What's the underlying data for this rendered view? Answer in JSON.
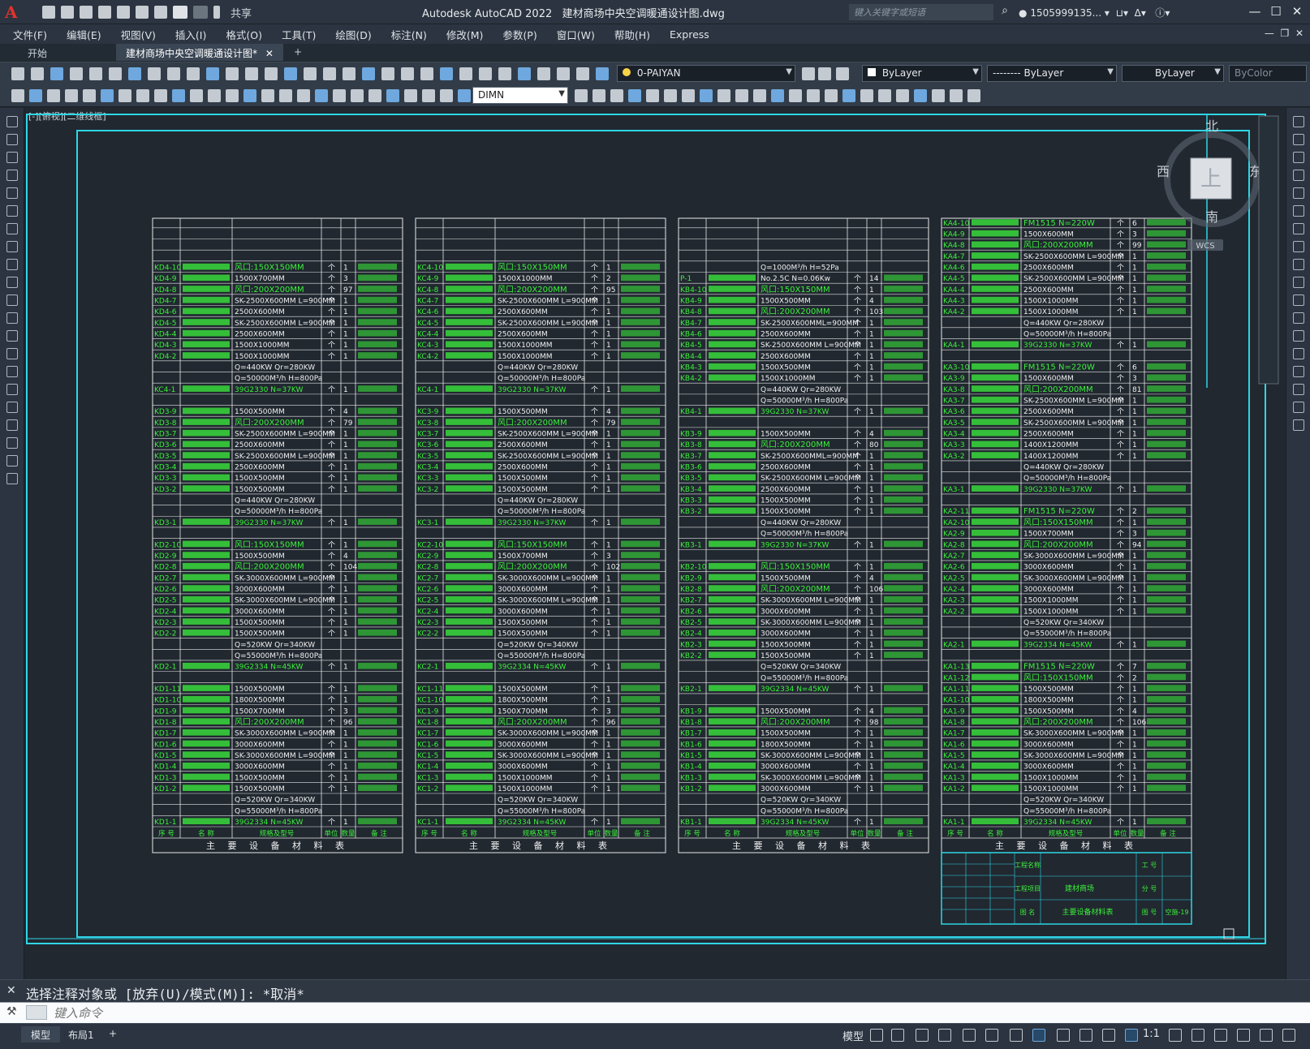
{
  "app": {
    "title": "Autodesk AutoCAD 2022",
    "filename": "建材商场中央空调暖通设计图.dwg",
    "share_label": "共享",
    "search_placeholder": "键入关键字或短语",
    "user": "1505999135...",
    "logo": "A"
  },
  "menu": [
    "文件(F)",
    "编辑(E)",
    "视图(V)",
    "插入(I)",
    "格式(O)",
    "工具(T)",
    "绘图(D)",
    "标注(N)",
    "修改(M)",
    "参数(P)",
    "窗口(W)",
    "帮助(H)",
    "Express"
  ],
  "tabs": {
    "start": "开始",
    "doc": "建材商场中央空调暖通设计图*",
    "close": "✕",
    "add": "+"
  },
  "toolbar": {
    "layer": "0-PAIYAN",
    "color": "ByLayer",
    "linetype": "-------- ByLayer",
    "lineweight": "ByLayer",
    "plotstyle": "ByColor",
    "dimstyle": "DIMN"
  },
  "viewport": {
    "label": "[-][俯视][二维线框]",
    "compass": {
      "n": "北",
      "s": "南",
      "e": "东",
      "w": "西",
      "top": "上"
    },
    "wcs": "WCS"
  },
  "drawing": {
    "table_title": "主 要 设 备 材 料 表",
    "headers": [
      "序 号",
      "名 称",
      "规格及型号",
      "单位",
      "数量",
      "备 注"
    ],
    "col1": [
      "KD4-10",
      "KD4-9",
      "KD4-8",
      "KD4-7",
      "KD4-6",
      "KD4-5",
      "KD4-4",
      "KD4-3",
      "KD4-2",
      "",
      "",
      "KC4-1",
      "",
      "KD3-9",
      "KD3-8",
      "KD3-7",
      "KD3-6",
      "KD3-5",
      "KD3-4",
      "KD3-3",
      "KD3-2",
      "",
      "",
      "KD3-1",
      "",
      "KD2-10",
      "KD2-9",
      "KD2-8",
      "KD2-7",
      "KD2-6",
      "KD2-5",
      "KD2-4",
      "KD2-3",
      "KD2-2",
      "",
      "",
      "KD2-1",
      "",
      "KD1-11",
      "KD1-10",
      "KD1-9",
      "KD1-8",
      "KD1-7",
      "KD1-6",
      "KD1-5",
      "KD1-4",
      "KD1-3",
      "KD1-2",
      "",
      "",
      "KD1-1"
    ],
    "col2": [
      "KC4-10",
      "KC4-9",
      "KC4-8",
      "KC4-7",
      "KC4-6",
      "KC4-5",
      "KC4-4",
      "KC4-3",
      "KC4-2",
      "",
      "",
      "KC4-1",
      "",
      "KC3-9",
      "KC3-8",
      "KC3-7",
      "KC3-6",
      "KC3-5",
      "KC3-4",
      "KC3-3",
      "KC3-2",
      "",
      "",
      "KC3-1",
      "",
      "KC2-10",
      "KC2-9",
      "KC2-8",
      "KC2-7",
      "KC2-6",
      "KC2-5",
      "KC2-4",
      "KC2-3",
      "KC2-2",
      "",
      "",
      "KC2-1",
      "",
      "KC1-11",
      "KC1-10",
      "KC1-9",
      "KC1-8",
      "KC1-7",
      "KC1-6",
      "KC1-5",
      "KC1-4",
      "KC1-3",
      "KC1-2",
      "",
      "",
      "KC1-1"
    ],
    "col3": [
      "",
      "P-1",
      "KB4-10",
      "KB4-9",
      "KB4-8",
      "KB4-7",
      "KB4-6",
      "KB4-5",
      "KB4-4",
      "KB4-3",
      "KB4-2",
      "",
      "",
      "KB4-1",
      "",
      "KB3-9",
      "KB3-8",
      "KB3-7",
      "KB3-6",
      "KB3-5",
      "KB3-4",
      "KB3-3",
      "KB3-2",
      "",
      "",
      "KB3-1",
      "",
      "KB2-10",
      "KB2-9",
      "KB2-8",
      "KB2-7",
      "KB2-6",
      "KB2-5",
      "KB2-4",
      "KB2-3",
      "KB2-2",
      "",
      "",
      "KB2-1",
      "",
      "KB1-9",
      "KB1-8",
      "KB1-7",
      "KB1-6",
      "KB1-5",
      "KB1-4",
      "KB1-3",
      "KB1-2",
      "",
      "",
      "KB1-1"
    ],
    "col4": [
      "KA4-10",
      "KA4-9",
      "KA4-8",
      "KA4-7",
      "KA4-6",
      "KA4-5",
      "KA4-4",
      "KA4-3",
      "KA4-2",
      "",
      "",
      "KA4-1",
      "",
      "KA3-10",
      "KA3-9",
      "KA3-8",
      "KA3-7",
      "KA3-6",
      "KA3-5",
      "KA3-4",
      "KA3-3",
      "KA3-2",
      "",
      "",
      "KA3-1",
      "",
      "KA2-11",
      "KA2-10",
      "KA2-9",
      "KA2-8",
      "KA2-7",
      "KA2-6",
      "KA2-5",
      "KA2-4",
      "KA2-3",
      "KA2-2",
      "",
      "",
      "KA2-1",
      "",
      "KA1-13",
      "KA1-12",
      "KA1-11",
      "KA1-10",
      "KA1-9",
      "KA1-8",
      "KA1-7",
      "KA1-6",
      "KA1-5",
      "KA1-4",
      "KA1-3",
      "KA1-2",
      "",
      "",
      "KA1-1"
    ],
    "specs_a": {
      "KD4-10": "风口:150X150MM",
      "KD4-9": "1500X700MM",
      "KD4-8": "风口:200X200MM",
      "KD4-7": "SK-2500X600MM L=900MM",
      "KD4-6": "2500X600MM",
      "KD4-5": "SK-2500X600MM L=900MM",
      "KD4-4": "2500X600MM",
      "KD4-3": "1500X1000MM",
      "KD4-2": "1500X1000MM",
      "KD3-9": "1500X500MM",
      "KD3-8": "风口:200X200MM",
      "KD3-7": "SK-2500X600MM L=900MM",
      "KD3-6": "2500X600MM",
      "KD3-5": "SK-2500X600MM L=900MM",
      "KD3-4": "2500X600MM",
      "KD3-3": "1500X500MM",
      "KD3-2": "1500X500MM",
      "KD2-10": "风口:150X150MM",
      "KD2-9": "1500X500MM",
      "KD2-8": "风口:200X200MM",
      "KD2-7": "SK-3000X600MM L=900MM",
      "KD2-6": "3000X600MM",
      "KD2-5": "SK-3000X600MM L=900MM",
      "KD2-4": "3000X600MM",
      "KD2-3": "1500X500MM",
      "KD2-2": "1500X500MM",
      "KD1-11": "1500X500MM",
      "KD1-10": "1800X500MM",
      "KD1-9": "1500X700MM",
      "KD1-8": "风口:200X200MM",
      "KD1-7": "SK-3000X600MM L=900MM",
      "KD1-6": "3000X600MM",
      "KD1-5": "SK-3000X600MM L=900MM",
      "KD1-4": "3000X600MM",
      "KD1-3": "1500X500MM",
      "KD1-2": "1500X500MM",
      "KC4-10": "风口:150X150MM",
      "KC4-9": "1500X1000MM",
      "KC4-8": "风口:200X200MM",
      "KC4-7": "SK-2500X600MM L=900MM",
      "KC4-6": "2500X600MM",
      "KC4-5": "SK-2500X600MM L=900MM",
      "KC4-4": "2500X600MM",
      "KC4-3": "1500X1000MM",
      "KC4-2": "1500X1000MM",
      "KC3-9": "1500X500MM",
      "KC3-8": "风口:200X200MM",
      "KC3-7": "SK-2500X600MM L=900MM",
      "KC3-6": "2500X600MM",
      "KC3-5": "SK-2500X600MM L=900MM",
      "KC3-4": "2500X600MM",
      "KC3-3": "1500X500MM",
      "KC3-2": "1500X500MM",
      "KC2-10": "风口:150X150MM",
      "KC2-9": "1500X700MM",
      "KC2-8": "风口:200X200MM",
      "KC2-7": "SK-3000X600MM L=900MM",
      "KC2-6": "3000X600MM",
      "KC2-5": "SK-3000X600MM L=900MM",
      "KC2-4": "3000X600MM",
      "KC2-3": "1500X500MM",
      "KC2-2": "1500X500MM",
      "KC1-11": "1500X500MM",
      "KC1-10": "1800X500MM",
      "KC1-9": "1500X700MM",
      "KC1-8": "风口:200X200MM",
      "KC1-7": "SK-3000X600MM L=900MM",
      "KC1-6": "3000X600MM",
      "KC1-5": "SK-3000X600MM L=900MM",
      "KC1-4": "3000X600MM",
      "KC1-3": "1500X1000MM",
      "KC1-2": "1500X1000MM",
      "P-1": "No.2.5C    N=0.06Kw",
      "KB4-10": "风口:150X150MM",
      "KB4-9": "1500X500MM",
      "KB4-8": "风口:200X200MM",
      "KB4-7": "SK-2500X600MML=900MM",
      "KB4-6": "2500X600MM",
      "KB4-5": "SK-2500X600MM L=900MM",
      "KB4-4": "2500X600MM",
      "KB4-3": "1500X500MM",
      "KB4-2": "1500X1000MM",
      "KB3-9": "1500X500MM",
      "KB3-8": "风口:200X200MM",
      "KB3-7": "SK-2500X600MML=900MM",
      "KB3-6": "2500X600MM",
      "KB3-5": "SK-2500X600MM L=900MM",
      "KB3-4": "2500X600MM",
      "KB3-3": "1500X500MM",
      "KB3-2": "1500X500MM",
      "KB2-10": "风口:150X150MM",
      "KB2-9": "1500X500MM",
      "KB2-8": "风口:200X200MM",
      "KB2-7": "SK-3000X600MM L=900MM",
      "KB2-6": "3000X600MM",
      "KB2-5": "SK-3000X600MM L=900MM",
      "KB2-4": "3000X600MM",
      "KB2-3": "1500X500MM",
      "KB2-2": "1500X500MM",
      "KB1-9": "1500X500MM",
      "KB1-8": "风口:200X200MM",
      "KB1-7": "1500X500MM",
      "KB1-6": "1800X500MM",
      "KB1-5": "SK-3000X600MM L=900MM",
      "KB1-4": "3000X600MM",
      "KB1-3": "SK-3000X600MM L=900MM",
      "KB1-2": "3000X600MM",
      "KA4-10": "FM1515      N=220W",
      "KA4-9": "1500X600MM",
      "KA4-8": "风口:200X200MM",
      "KA4-7": "SK-2500X600MM L=900MM",
      "KA4-6": "2500X600MM",
      "KA4-5": "SK-2500X600MM L=900MM",
      "KA4-4": "2500X600MM",
      "KA4-3": "1500X1000MM",
      "KA4-2": "1500X1000MM",
      "KA3-10": "FM1515      N=220W",
      "KA3-9": "1500X600MM",
      "KA3-8": "风口:200X200MM",
      "KA3-7": "SK-2500X600MM L=900MM",
      "KA3-6": "2500X600MM",
      "KA3-5": "SK-2500X600MM L=900MM",
      "KA3-4": "2500X600MM",
      "KA3-3": "1400X1200MM",
      "KA3-2": "1400X1200MM",
      "KA2-11": "FM1515      N=220W",
      "KA2-10": "风口:150X150MM",
      "KA2-9": "1500X700MM",
      "KA2-8": "风口:200X200MM",
      "KA2-7": "SK-3000X600MM L=900MM",
      "KA2-6": "3000X600MM",
      "KA2-5": "SK-3000X600MM L=900MM",
      "KA2-4": "3000X600MM",
      "KA2-3": "1500X1000MM",
      "KA2-2": "1500X1000MM",
      "KA1-13": "FM1515      N=220W",
      "KA1-12": "风口:150X150MM",
      "KA1-11": "1500X500MM",
      "KA1-10": "1800X500MM",
      "KA1-9": "1500X500MM",
      "KA1-8": "风口:200X200MM",
      "KA1-7": "SK-3000X600MM L=900MM",
      "KA1-6": "3000X600MM",
      "KA1-5": "SK-3000X600MM L=900MM",
      "KA1-4": "3000X600MM",
      "KA1-3": "1500X1000MM",
      "KA1-2": "1500X1000MM"
    },
    "qty": {
      "KD4-9": "3",
      "KD4-8": "97",
      "KC4-9": "2",
      "KC4-8": "95",
      "P-1": "14",
      "KB4-9": "4",
      "KB4-8": "103",
      "KA4-10": "6",
      "KA4-9": "3",
      "KA4-8": "99",
      "KD3-9": "4",
      "KD3-8": "79",
      "KC3-9": "4",
      "KC3-8": "79",
      "KB3-9": "4",
      "KB3-8": "80",
      "KA3-10": "6",
      "KA3-9": "3",
      "KA3-8": "81",
      "KD2-9": "4",
      "KD2-8": "104",
      "KC2-9": "3",
      "KC2-8": "102",
      "KB2-9": "4",
      "KB2-8": "106",
      "KA2-11": "2",
      "KA2-9": "3",
      "KA2-8": "94",
      "KD1-9": "3",
      "KD1-8": "96",
      "KC1-9": "3",
      "KC1-8": "96",
      "KB1-9": "4",
      "KB1-8": "98",
      "KA1-13": "7",
      "KA1-12": "2",
      "KA1-9": "4",
      "KA1-8": "106"
    },
    "units": {
      "KW440": "Q=440KW    Qr=280KW",
      "KW440b": "Q=50000M³/h   H=800Pa",
      "KW520": "Q=520KW    Qr=340KW",
      "KW520b": "Q=55000M³/h   H=800Pa",
      "ahu37": "39G2330      N=37KW",
      "ahu45": "39G2334      N=45KW",
      "pump": "Q=1000M³/h    H=52Pa"
    },
    "title_block": {
      "project": "建材商场",
      "sheet": "主要设备材料表",
      "number": "空施-19",
      "labels": [
        "工程名称",
        "工程项目",
        "图 名",
        "工 号",
        "分 号",
        "图 号"
      ]
    }
  },
  "command": {
    "history": "选择注释对象或 [放弃(U)/模式(M)]: *取消*",
    "placeholder": "键入命令"
  },
  "status": {
    "model_tab": "模型",
    "layout_tab": "布局1",
    "add": "+",
    "model_label": "模型",
    "scale": "1:1"
  }
}
